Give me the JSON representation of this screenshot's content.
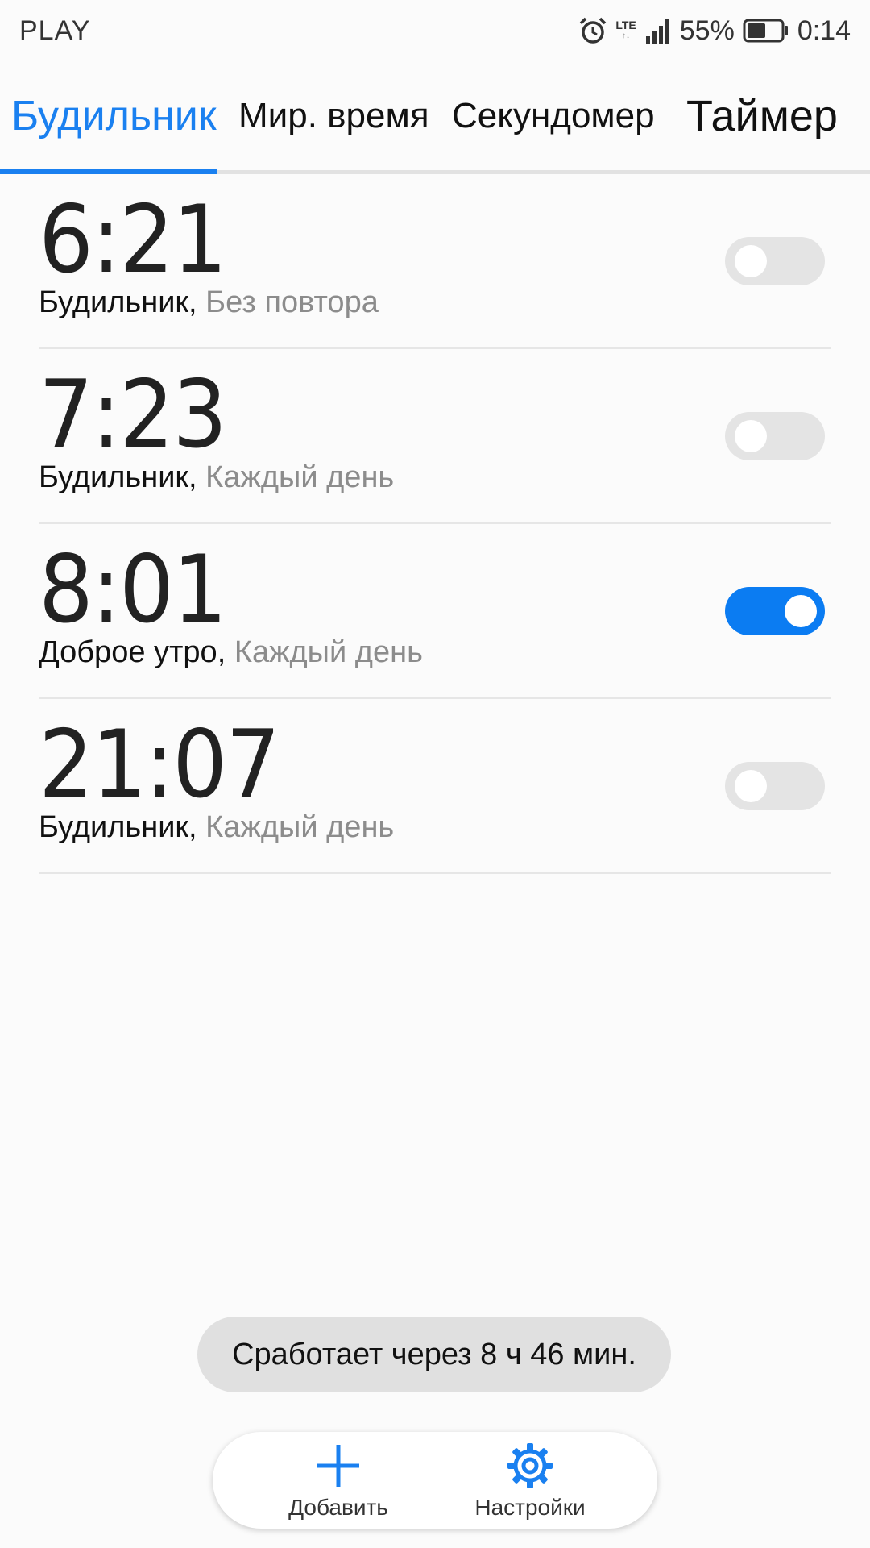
{
  "status_bar": {
    "carrier": "PLAY",
    "network": "LTE",
    "battery": "55%",
    "battery_level": 0.55,
    "time": "0:14",
    "icons": [
      "alarm-clock-icon",
      "lte-icon",
      "signal-icon",
      "battery-icon"
    ]
  },
  "tabs": [
    {
      "label": "Будильник",
      "active": true
    },
    {
      "label": "Мир. время",
      "active": false
    },
    {
      "label": "Секундомер",
      "active": false
    },
    {
      "label": "Таймер",
      "active": false
    }
  ],
  "alarms": [
    {
      "time": "6:21",
      "label": "Будильник,",
      "repeat": "Без повтора",
      "enabled": false
    },
    {
      "time": "7:23",
      "label": "Будильник,",
      "repeat": "Каждый день",
      "enabled": false
    },
    {
      "time": "8:01",
      "label": "Доброе утро,",
      "repeat": "Каждый день",
      "enabled": true
    },
    {
      "time": "21:07",
      "label": "Будильник,",
      "repeat": "Каждый день",
      "enabled": false
    }
  ],
  "toast": "Сработает через 8 ч 46 мин.",
  "actions": {
    "add_label": "Добавить",
    "settings_label": "Настройки"
  },
  "colors": {
    "accent": "#1a80f0",
    "toggle_on": "#0b7cf2",
    "toggle_off": "#e4e4e4"
  }
}
